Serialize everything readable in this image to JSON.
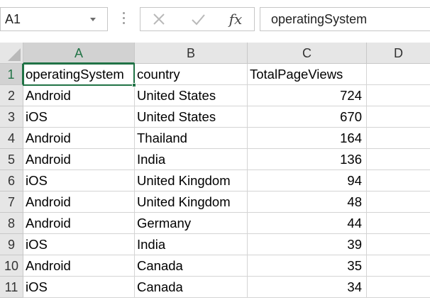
{
  "name_box": {
    "value": "A1"
  },
  "formula_bar": {
    "value": "operatingSystem",
    "insert_function_label": "fx"
  },
  "columns": [
    "A",
    "B",
    "C",
    "D"
  ],
  "rows": [
    {
      "num": "1",
      "os": "operatingSystem",
      "country": "country",
      "views": "TotalPageViews"
    },
    {
      "num": "2",
      "os": "Android",
      "country": "United States",
      "views": "724"
    },
    {
      "num": "3",
      "os": "iOS",
      "country": "United States",
      "views": "670"
    },
    {
      "num": "4",
      "os": "Android",
      "country": "Thailand",
      "views": "164"
    },
    {
      "num": "5",
      "os": "Android",
      "country": "India",
      "views": "136"
    },
    {
      "num": "6",
      "os": "iOS",
      "country": "United Kingdom",
      "views": "94"
    },
    {
      "num": "7",
      "os": "Android",
      "country": "United Kingdom",
      "views": "48"
    },
    {
      "num": "8",
      "os": "Android",
      "country": "Germany",
      "views": "44"
    },
    {
      "num": "9",
      "os": "iOS",
      "country": "India",
      "views": "39"
    },
    {
      "num": "10",
      "os": "Android",
      "country": "Canada",
      "views": "35"
    },
    {
      "num": "11",
      "os": "iOS",
      "country": "Canada",
      "views": "34"
    }
  ],
  "colors": {
    "accent": "#217346",
    "header_bg": "#e6e6e6",
    "gridline": "#d4d4d4"
  }
}
